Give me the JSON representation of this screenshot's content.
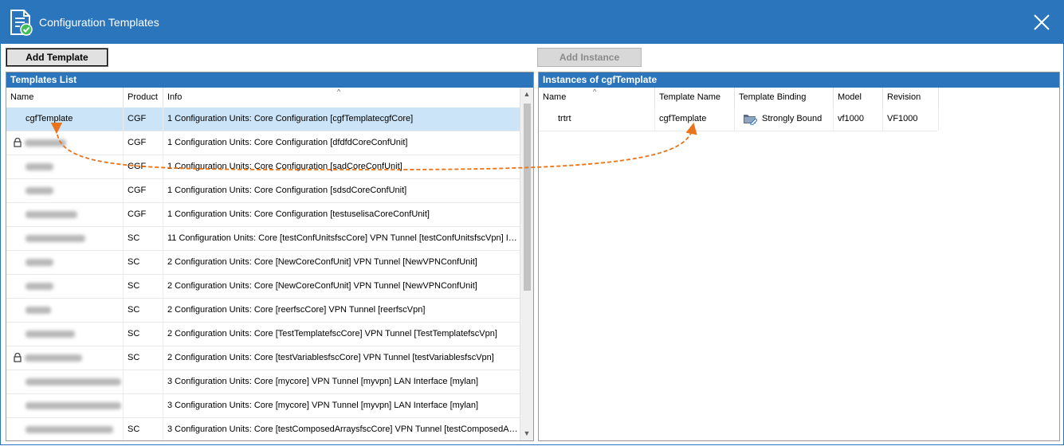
{
  "window": {
    "title": "Configuration Templates",
    "accent": "#2a75bc",
    "icon": "document-check-icon",
    "close_icon": "close-icon"
  },
  "toolbar": {
    "add_template_label": "Add Template",
    "add_instance_label": "Add Instance"
  },
  "templates": {
    "header": "Templates List",
    "columns": [
      "Name",
      "Product",
      "Info"
    ],
    "rows": [
      {
        "name": "cgfTemplate",
        "product": "CGF",
        "info": "1 Configuration Units: Core Configuration [cgfTemplatecgfCore]"
      },
      {
        "name": "",
        "product": "CGF",
        "info": "1 Configuration Units: Core Configuration [dfdfdCoreConfUnit]"
      },
      {
        "name": "",
        "product": "CGF",
        "info": "1 Configuration Units: Core Configuration [sadCoreConfUnit]"
      },
      {
        "name": "",
        "product": "CGF",
        "info": "1 Configuration Units: Core Configuration [sdsdCoreConfUnit]"
      },
      {
        "name": "",
        "product": "CGF",
        "info": "1 Configuration Units: Core Configuration [testuselisaCoreConfUnit]"
      },
      {
        "name": "",
        "product": "SC",
        "info": "11 Configuration Units: Core [testConfUnitsfscCore] VPN Tunnel [testConfUnitsfscVpn] Indi..."
      },
      {
        "name": "",
        "product": "SC",
        "info": "2 Configuration Units: Core [NewCoreConfUnit] VPN Tunnel [NewVPNConfUnit]"
      },
      {
        "name": "",
        "product": "SC",
        "info": "2 Configuration Units: Core [NewCoreConfUnit] VPN Tunnel [NewVPNConfUnit]"
      },
      {
        "name": "",
        "product": "SC",
        "info": "2 Configuration Units: Core [reerfscCore] VPN Tunnel [reerfscVpn]"
      },
      {
        "name": "",
        "product": "SC",
        "info": "2 Configuration Units: Core [TestTemplatefscCore] VPN Tunnel [TestTemplatefscVpn]"
      },
      {
        "name": "",
        "product": "SC",
        "info": "2 Configuration Units: Core [testVariablesfscCore] VPN Tunnel [testVariablesfscVpn]"
      },
      {
        "name": "",
        "product": "",
        "info": "3 Configuration Units: Core [mycore] VPN Tunnel [myvpn] LAN Interface [mylan]"
      },
      {
        "name": "",
        "product": "",
        "info": "3 Configuration Units: Core [mycore] VPN Tunnel [myvpn] LAN Interface [mylan]"
      },
      {
        "name": "",
        "product": "SC",
        "info": "3 Configuration Units: Core [testComposedArraysfscCore] VPN Tunnel [testComposedArrays..."
      }
    ]
  },
  "instances": {
    "header": "Instances of cgfTemplate",
    "columns": [
      "Name",
      "Template Name",
      "Template Binding",
      "Model",
      "Revision"
    ],
    "rows": [
      {
        "name": "trtrt",
        "template_name": "cgfTemplate",
        "binding": "Strongly Bound",
        "model": "vf1000",
        "revision": "VF1000"
      }
    ]
  },
  "annotation": {
    "color": "#e8731a"
  }
}
